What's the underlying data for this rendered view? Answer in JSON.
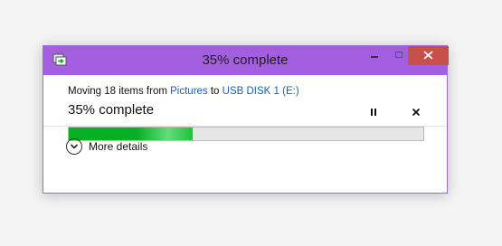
{
  "window": {
    "title": "35% complete",
    "accent_color": "#a35fe0",
    "close_color": "#c7504c"
  },
  "title_controls": {
    "minimize_icon": "minimize-icon",
    "maximize_icon": "maximize-icon",
    "close_icon": "close-icon"
  },
  "operation": {
    "prefix": "Moving 18 items from ",
    "source": "Pictures",
    "connector": " to ",
    "destination": "USB DISK 1 (E:)",
    "status": "35% complete",
    "progress": 0.35,
    "progress_color": "#06b025"
  },
  "actions": {
    "pause_icon": "pause-icon",
    "cancel_icon": "cancel-icon"
  },
  "details": {
    "label": "More details",
    "icon": "chevron-down-icon"
  }
}
